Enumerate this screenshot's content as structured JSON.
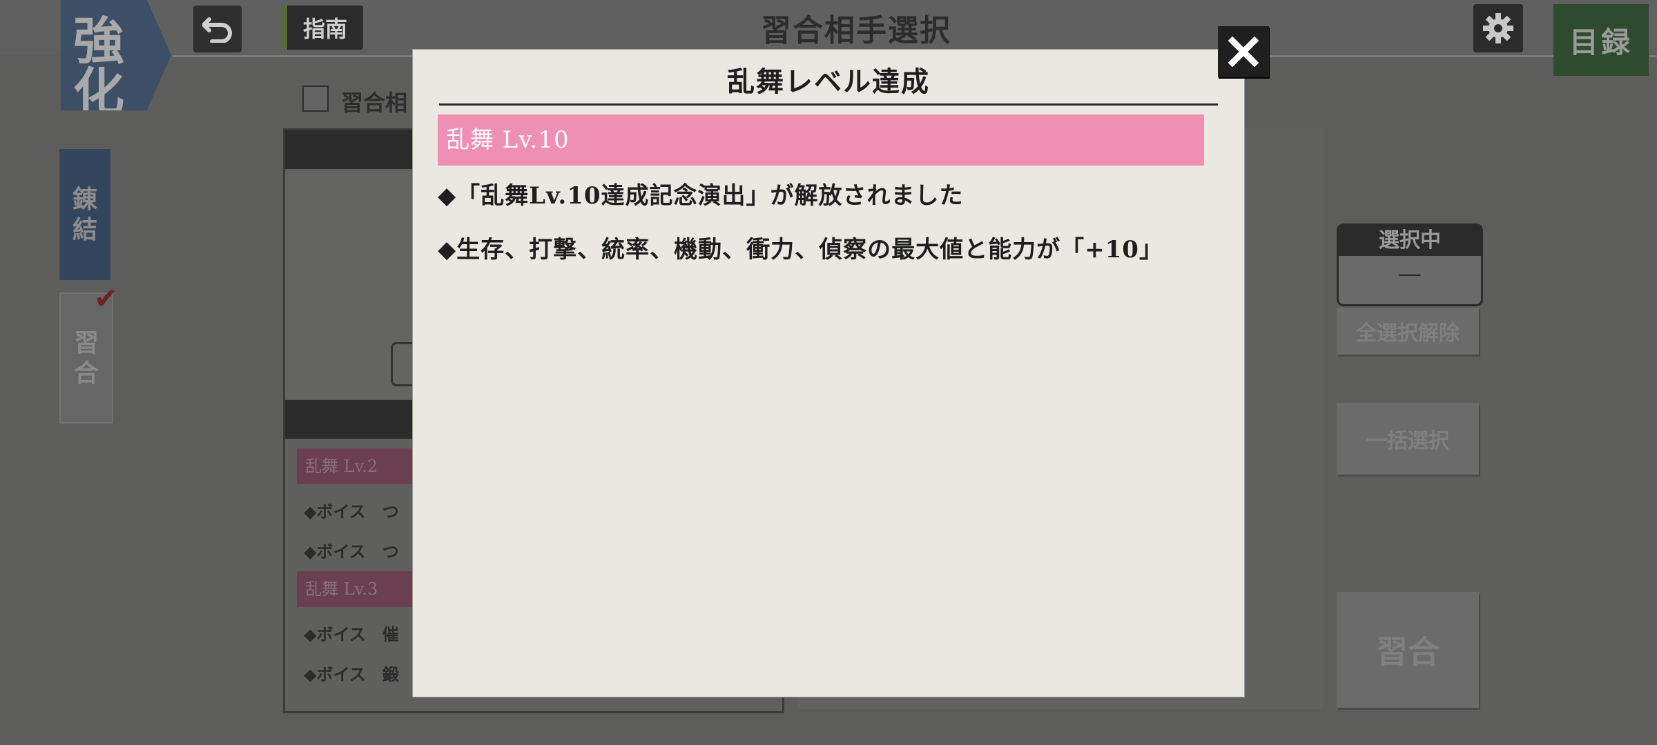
{
  "category_tab": {
    "line1": "強",
    "line2": "化"
  },
  "header": {
    "title": "習合相手選択",
    "guide_label": "指南",
    "catalog_label": "目録"
  },
  "side_tabs": [
    {
      "label_line1": "錬",
      "label_line2": "結"
    },
    {
      "label_line1": "習",
      "label_line2": "合"
    }
  ],
  "filter": {
    "label": "習合相"
  },
  "list": {
    "entries": [
      {
        "level": "乱舞 Lv.2",
        "lines": [
          "◆ボイス　つ",
          "◆ボイス　つ"
        ]
      },
      {
        "level": "乱舞 Lv.3",
        "lines": [
          "◆ボイス　催",
          "◆ボイス　鍛"
        ]
      }
    ]
  },
  "selection": {
    "header": "選択中",
    "value": "—",
    "clear_all_label": "全選択解除",
    "bulk_select_label": "一括選択",
    "train_label": "習合"
  },
  "modal": {
    "title": "乱舞レベル達成",
    "level_banner": "乱舞 Lv.10",
    "rewards": [
      "◆「乱舞Lv.10達成記念演出」が解放されました",
      "◆生存、打撃、統率、機動、衝力、偵察の最大値と能力が「+10」"
    ],
    "close_icon": "close-x-icon"
  },
  "colors": {
    "level_banner": "#ef8fb4",
    "modal_background": "#ebe8e1",
    "dim_overlay": "#5d5d5b"
  }
}
